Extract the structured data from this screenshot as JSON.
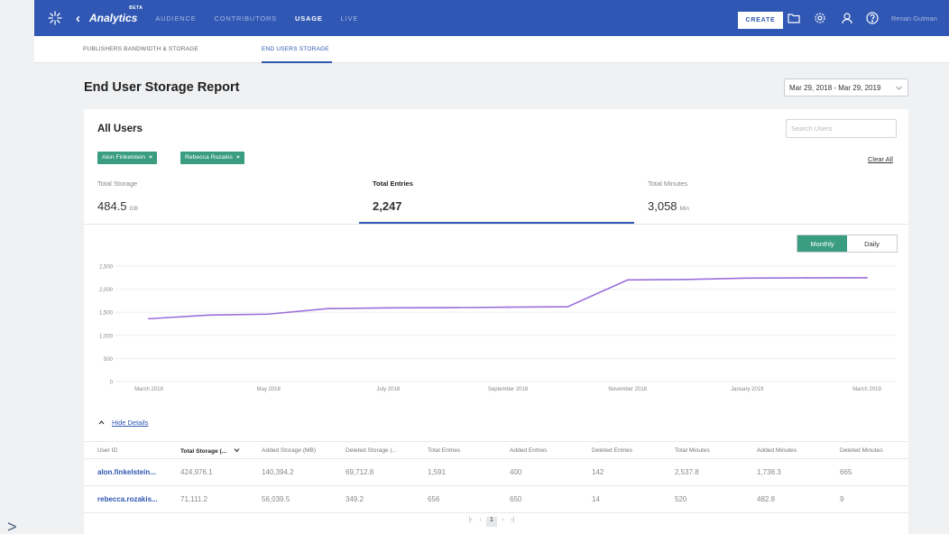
{
  "nav": {
    "app_title": "Analytics",
    "beta": "BETA",
    "items": [
      {
        "label": "AUDIENCE",
        "active": false
      },
      {
        "label": "CONTRIBUTORS",
        "active": false
      },
      {
        "label": "USAGE",
        "active": true
      },
      {
        "label": "LIVE",
        "active": false
      }
    ],
    "create_label": "CREATE",
    "user_name": "Renan Gutman"
  },
  "subtabs": [
    {
      "label": "PUBLISHERS BANDWIDTH & STORAGE",
      "active": false
    },
    {
      "label": "END USERS STORAGE",
      "active": true
    }
  ],
  "page_title": "End User Storage Report",
  "date_range": "Mar 29, 2018 - Mar 29, 2019",
  "card": {
    "title": "All Users",
    "search_placeholder": "Search Users",
    "chips": [
      "Alon Finkelstein",
      "Rebecca Rozakis"
    ],
    "clear_all": "Clear All",
    "stats": [
      {
        "label": "Total Storage",
        "value": "484.5",
        "unit": "GB",
        "active": false
      },
      {
        "label": "Total Entries",
        "value": "2,247",
        "unit": "",
        "active": true
      },
      {
        "label": "Total Minutes",
        "value": "3,058",
        "unit": "Min",
        "active": false
      }
    ],
    "toggle": {
      "monthly": "Monthly",
      "daily": "Daily",
      "selected": "Monthly"
    },
    "hide_details": "Hide Details"
  },
  "chart_data": {
    "type": "line",
    "y_ticks": [
      "0",
      "500",
      "1,000",
      "1,500",
      "2,000",
      "2,500"
    ],
    "ylim": [
      0,
      2500
    ],
    "x_tick_labels": [
      "March 2018",
      "May 2018",
      "July 2018",
      "September 2018",
      "November 2018",
      "January 2019",
      "March 2019"
    ],
    "x": [
      "Mar 2018",
      "Apr 2018",
      "May 2018",
      "Jun 2018",
      "Jul 2018",
      "Aug 2018",
      "Sep 2018",
      "Oct 2018",
      "Nov 2018",
      "Dec 2018",
      "Jan 2019",
      "Feb 2019",
      "Mar 2019"
    ],
    "values": [
      1360,
      1440,
      1460,
      1580,
      1595,
      1600,
      1610,
      1620,
      2200,
      2210,
      2240,
      2245,
      2247
    ],
    "color": "#9b6fdb",
    "grid": true
  },
  "table": {
    "columns": [
      "User ID",
      "Total Storage (...",
      "Added Storage (MB)",
      "Deleted Storage (...",
      "Total Entries",
      "Added Entries",
      "Deleted Entries",
      "Total Minutes",
      "Added Minutes",
      "Deleted Minutes"
    ],
    "rows": [
      [
        "alon.finkelstein...",
        "424,976.1",
        "140,394.2",
        "69,712.8",
        "1,591",
        "400",
        "142",
        "2,537.8",
        "1,738.3",
        "665"
      ],
      [
        "rebecca.rozakis...",
        "71,111.2",
        "56,039.5",
        "349.2",
        "656",
        "650",
        "14",
        "520",
        "482.8",
        "9"
      ]
    ]
  },
  "pager": {
    "current": "1"
  },
  "colors": {
    "nav": "#2f57b3",
    "accent_green": "#3a9d80",
    "series": "#9b6fdb"
  }
}
